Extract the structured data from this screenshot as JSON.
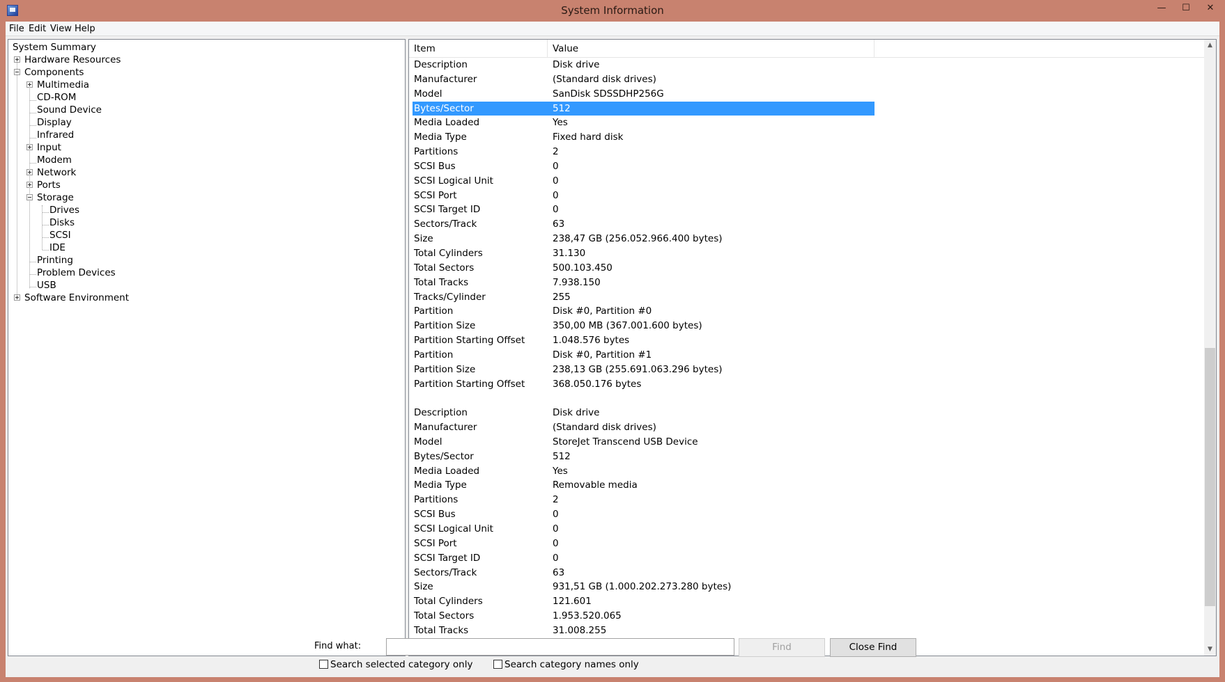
{
  "window": {
    "title": "System Information",
    "minimize_glyph": "—",
    "maximize_glyph": "☐",
    "close_glyph": "✕"
  },
  "menu": [
    "File",
    "Edit",
    "View",
    "Help"
  ],
  "tree": [
    {
      "label": "System Summary"
    },
    {
      "label": "Hardware Resources"
    },
    {
      "label": "Components"
    },
    {
      "label": "Multimedia"
    },
    {
      "label": "CD-ROM"
    },
    {
      "label": "Sound Device"
    },
    {
      "label": "Display"
    },
    {
      "label": "Infrared"
    },
    {
      "label": "Input"
    },
    {
      "label": "Modem"
    },
    {
      "label": "Network"
    },
    {
      "label": "Ports"
    },
    {
      "label": "Storage"
    },
    {
      "label": "Drives"
    },
    {
      "label": "Disks"
    },
    {
      "label": "SCSI"
    },
    {
      "label": "IDE"
    },
    {
      "label": "Printing"
    },
    {
      "label": "Problem Devices"
    },
    {
      "label": "USB"
    },
    {
      "label": "Software Environment"
    }
  ],
  "list": {
    "columns": {
      "item": "Item",
      "value": "Value"
    },
    "rows": [
      {
        "item": "Description",
        "value": "Disk drive"
      },
      {
        "item": "Manufacturer",
        "value": "(Standard disk drives)"
      },
      {
        "item": "Model",
        "value": "SanDisk SDSSDHP256G"
      },
      {
        "item": "Bytes/Sector",
        "value": "512"
      },
      {
        "item": "Media Loaded",
        "value": "Yes"
      },
      {
        "item": "Media Type",
        "value": "Fixed hard disk"
      },
      {
        "item": "Partitions",
        "value": "2"
      },
      {
        "item": "SCSI Bus",
        "value": "0"
      },
      {
        "item": "SCSI Logical Unit",
        "value": "0"
      },
      {
        "item": "SCSI Port",
        "value": "0"
      },
      {
        "item": "SCSI Target ID",
        "value": "0"
      },
      {
        "item": "Sectors/Track",
        "value": "63"
      },
      {
        "item": "Size",
        "value": "238,47 GB (256.052.966.400 bytes)"
      },
      {
        "item": "Total Cylinders",
        "value": "31.130"
      },
      {
        "item": "Total Sectors",
        "value": "500.103.450"
      },
      {
        "item": "Total Tracks",
        "value": "7.938.150"
      },
      {
        "item": "Tracks/Cylinder",
        "value": "255"
      },
      {
        "item": "Partition",
        "value": "Disk #0, Partition #0"
      },
      {
        "item": "Partition Size",
        "value": "350,00 MB (367.001.600 bytes)"
      },
      {
        "item": "Partition Starting Offset",
        "value": "1.048.576 bytes"
      },
      {
        "item": "Partition",
        "value": "Disk #0, Partition #1"
      },
      {
        "item": "Partition Size",
        "value": "238,13 GB (255.691.063.296 bytes)"
      },
      {
        "item": "Partition Starting Offset",
        "value": "368.050.176 bytes"
      },
      {
        "item": "",
        "value": ""
      },
      {
        "item": "Description",
        "value": "Disk drive"
      },
      {
        "item": "Manufacturer",
        "value": "(Standard disk drives)"
      },
      {
        "item": "Model",
        "value": "StoreJet Transcend USB Device"
      },
      {
        "item": "Bytes/Sector",
        "value": "512"
      },
      {
        "item": "Media Loaded",
        "value": "Yes"
      },
      {
        "item": "Media Type",
        "value": "Removable media"
      },
      {
        "item": "Partitions",
        "value": "2"
      },
      {
        "item": "SCSI Bus",
        "value": "0"
      },
      {
        "item": "SCSI Logical Unit",
        "value": "0"
      },
      {
        "item": "SCSI Port",
        "value": "0"
      },
      {
        "item": "SCSI Target ID",
        "value": "0"
      },
      {
        "item": "Sectors/Track",
        "value": "63"
      },
      {
        "item": "Size",
        "value": "931,51 GB (1.000.202.273.280 bytes)"
      },
      {
        "item": "Total Cylinders",
        "value": "121.601"
      },
      {
        "item": "Total Sectors",
        "value": "1.953.520.065"
      },
      {
        "item": "Total Tracks",
        "value": "31.008.255"
      }
    ]
  },
  "find": {
    "label": "Find what:",
    "value": "",
    "find_button": "Find",
    "close_find_button": "Close Find",
    "search_selected_label": "Search selected category only",
    "search_names_label": "Search category names only"
  },
  "colors": {
    "title_bar": "#c8826f",
    "selection": "#3399ff"
  }
}
